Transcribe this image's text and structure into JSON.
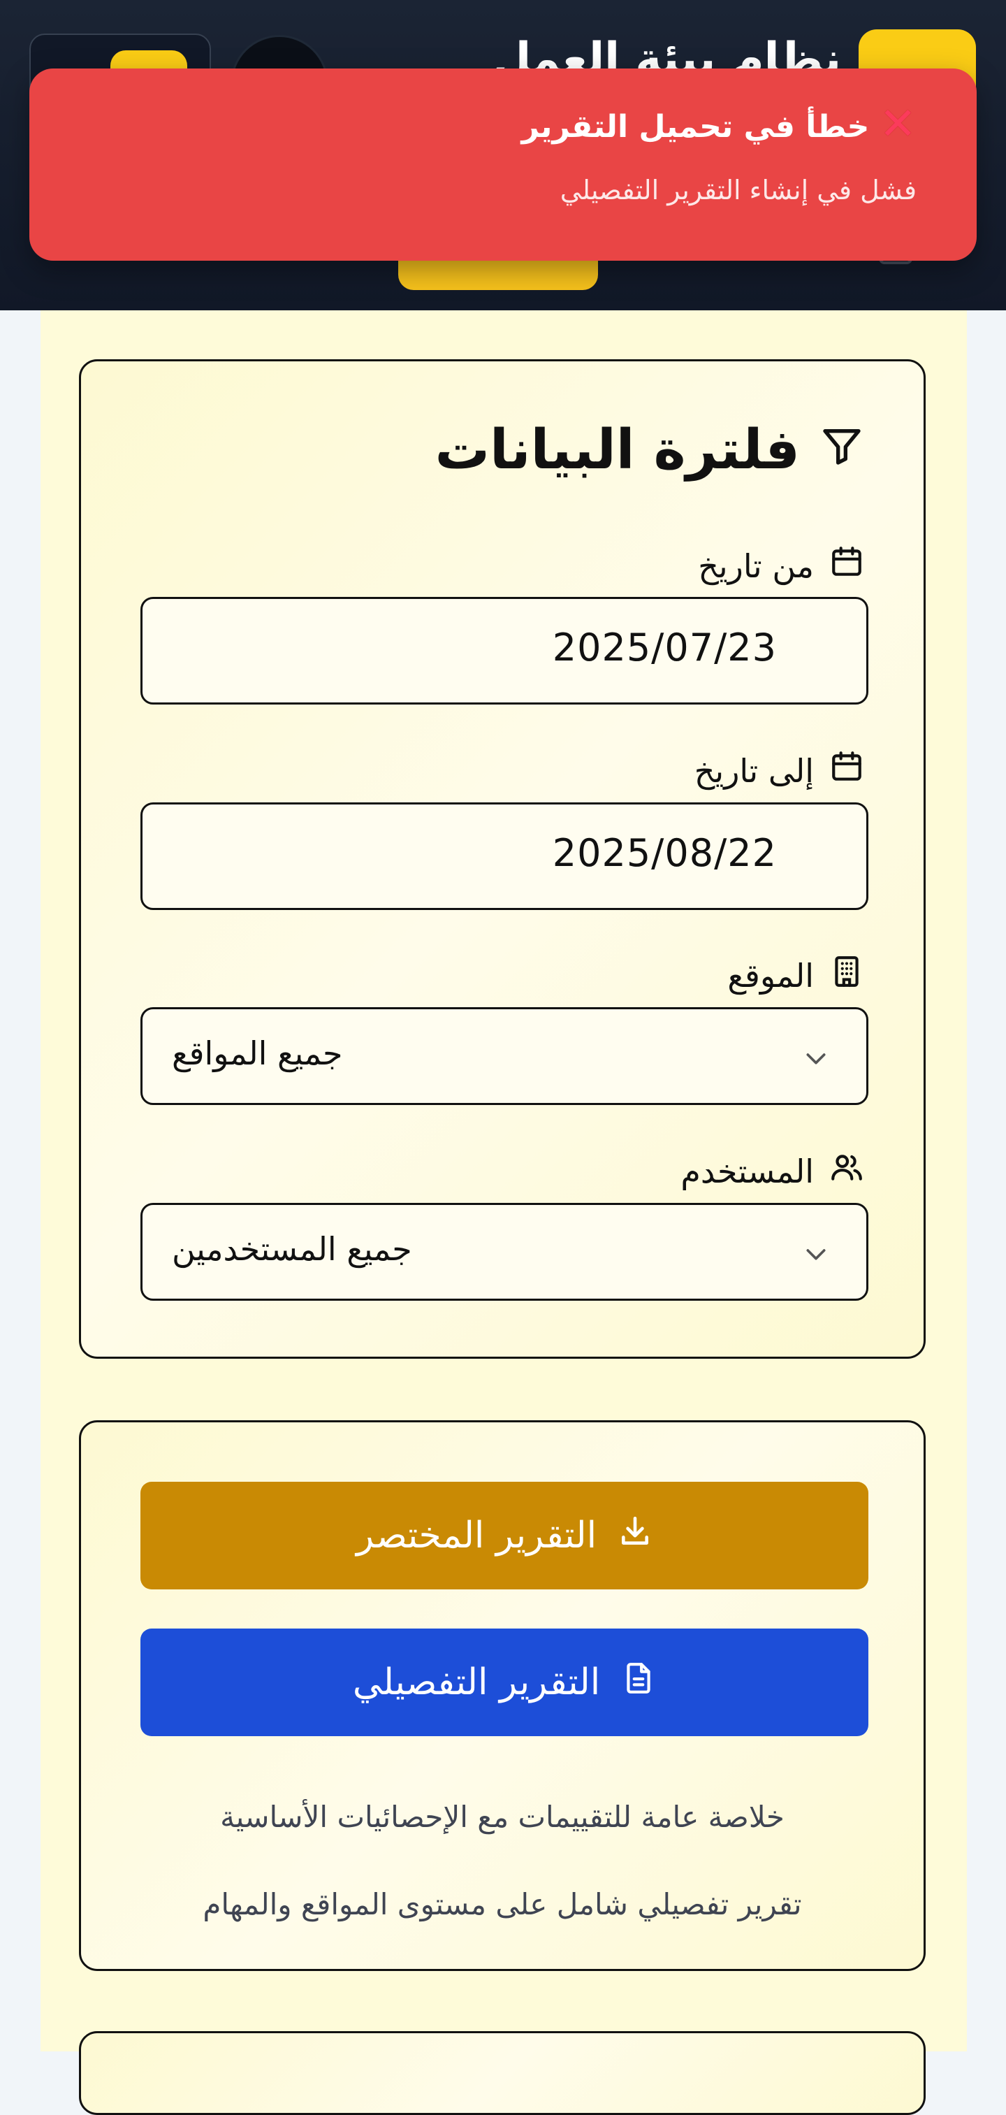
{
  "header": {
    "app_title": "نظام بيئة العمل"
  },
  "toast": {
    "title": "خطأ في تحميل التقرير",
    "message": "فشل في إنشاء التقرير التفصيلي",
    "icon": "close-x-icon",
    "color": "#e94545"
  },
  "filter": {
    "title": "فلترة البيانات",
    "icon": "filter-icon",
    "from_date": {
      "label": "من تاريخ",
      "value": "2025/07/23",
      "icon": "calendar-icon"
    },
    "to_date": {
      "label": "إلى تاريخ",
      "value": "2025/08/22",
      "icon": "calendar-icon"
    },
    "site": {
      "label": "الموقع",
      "selected": "جميع المواقع",
      "icon": "building-icon"
    },
    "user": {
      "label": "المستخدم",
      "selected": "جميع المستخدمين",
      "icon": "users-icon"
    }
  },
  "reports": {
    "brief_button": "التقرير المختصر",
    "brief_color": "#c98a04",
    "detailed_button": "التقرير التفصيلي",
    "detailed_color": "#1d4ed8",
    "brief_description": "خلاصة عامة للتقييمات مع الإحصائيات الأساسية",
    "detailed_description": "تقرير تفصيلي شامل على مستوى المواقع والمهام"
  }
}
